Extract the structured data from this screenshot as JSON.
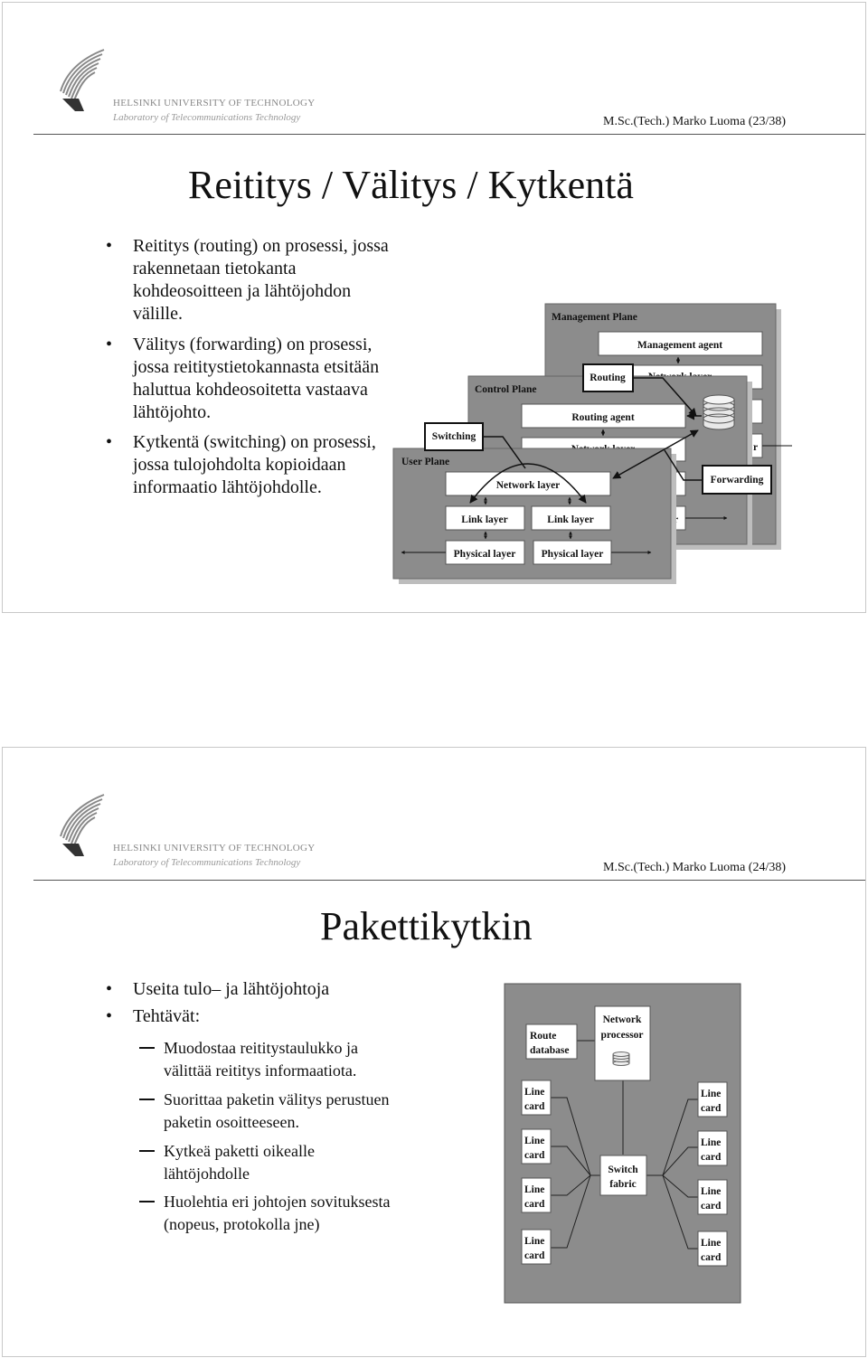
{
  "logo": {
    "university": "HELSINKI UNIVERSITY OF TECHNOLOGY",
    "lab": "Laboratory of Telecommunications Technology"
  },
  "slide1": {
    "header": "M.Sc.(Tech.) Marko Luoma (23/38)",
    "title": "Reititys / Välitys / Kytkentä",
    "bullets": [
      {
        "lines": [
          "Reititys (routing) on prosessi, jossa",
          "rakennetaan tietokanta",
          "kohdeosoitteen ja lähtöjohdon",
          "välille."
        ]
      },
      {
        "lines": [
          "Välitys (forwarding) on prosessi,",
          "jossa reititystietokannasta etsitään",
          "haluttua kohdeosoitetta vastaava",
          "lähtöjohto."
        ]
      },
      {
        "lines": [
          "Kytkentä (switching) on prosessi,",
          "jossa tulojohdolta kopioidaan",
          "informaatio lähtöjohdolle."
        ]
      }
    ],
    "diagram": {
      "management_plane": "Management Plane",
      "management_agent": "Management agent",
      "control_plane": "Control Plane",
      "routing_agent": "Routing agent",
      "network_layer": "Network layer",
      "user_plane": "User Plane",
      "link_layer": "Link layer",
      "physical_layer": "Physical layer",
      "routing": "Routing",
      "switching": "Switching",
      "forwarding": "Forwarding",
      "fragment_r": "r"
    }
  },
  "slide2": {
    "header": "M.Sc.(Tech.) Marko Luoma (24/38)",
    "title": "Pakettikytkin",
    "bullets": [
      "Useita tulo– ja lähtöjohtoja",
      "Tehtävät:"
    ],
    "sub_items": [
      {
        "lines": [
          "Muodostaa reititystaulukko  ja",
          "välittää reititys informaatiota."
        ]
      },
      {
        "lines": [
          "Suorittaa paketin välitys perustuen",
          "paketin osoitteeseen."
        ]
      },
      {
        "lines": [
          "Kytkeä paketti oikealle",
          "lähtöjohdolle"
        ]
      },
      {
        "lines": [
          "Huolehtia eri johtojen sovituksesta",
          "(nopeus, protokolla jne)"
        ]
      }
    ],
    "diagram": {
      "route_database": [
        "Route",
        "database"
      ],
      "network_processor": [
        "Network",
        "processor"
      ],
      "switch_fabric": [
        "Switch",
        "fabric"
      ],
      "line_card": [
        "Line",
        "card"
      ]
    }
  }
}
